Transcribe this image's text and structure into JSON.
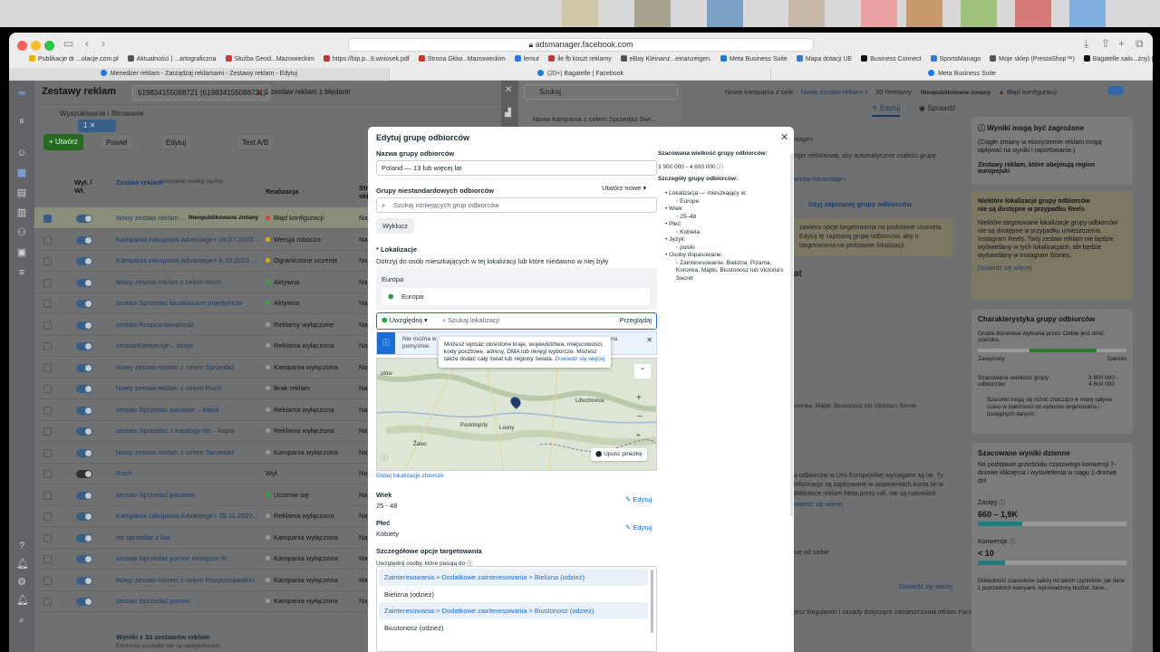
{
  "browser": {
    "url": "adsmanager.facebook.com",
    "bookmarks": [
      "Publikacje dr ...olacje.com.pl",
      "Aktualności | ...artograficzna",
      "Służba Geod...Mazowieckim",
      "https://bip.p...9,wniosek.pdf",
      "Strona Głów...Mazowieckim",
      "lemur",
      "ile fb koszt reklamy",
      "eBay Kleinanz...einanzeigen.",
      "Meta Business Suite",
      "Mapa dotacji UE",
      "Business Connect",
      "SportsManago",
      "Moje sklep (PrestaShop™)",
      "Bagatelle salo...żny) | TikTok"
    ],
    "tabs": [
      "Menedżer reklam - Zarządzaj reklamami - Zestawy reklam - Edytuj",
      "(20+) Bagatelle | Facebook",
      "Meta Business Suite"
    ]
  },
  "app": {
    "section_title": "Zestawy reklam",
    "account_selector": "619834155088721 (619834155088721)",
    "error_badge": "1 zestaw reklam z błędami",
    "search_placeholder": "Wyszukiwanie i filtrowanie",
    "toolbar": {
      "create": "+ Utwórz",
      "duplicate": "Powiel",
      "edit": "Edytuj",
      "ab_test": "Test A/B",
      "selected_count": "1"
    },
    "table_headers": {
      "toggle": "Wył. / Wł.",
      "name": "Zestaw reklam",
      "name_sort": "sortowanie według błędów",
      "delivery": "Realizacja",
      "budget": "Strate składa"
    },
    "rows": [
      {
        "name": "Nowy zestaw reklam ...",
        "badge": "Nieopublikowane zmiany",
        "status": "Błąd konfiguracji",
        "dot": "#d64545",
        "budget": "Naje"
      },
      {
        "name": "Kampania zakupowa Advantage+ 28.07.2023 ...",
        "status": "Wersja robocza",
        "dot": "#e0b000",
        "budget": "Naje"
      },
      {
        "name": "Kampania zakupowa Advantage+ 6.10.2023 ...",
        "status": "Ograniczone uczenie",
        "dot": "#e0b000",
        "budget": "Naje"
      },
      {
        "name": "Nowy zestaw reklam z celem Ruch",
        "status": "Aktywna",
        "dot": "#33a33a",
        "budget": "Naje"
      },
      {
        "name": "zestaw Sprzedaż biustonosze pojedyńcze",
        "status": "Aktywna",
        "dot": "#33a33a",
        "budget": "Naje"
      },
      {
        "name": "zestaw Rozpoznawalność",
        "status": "Reklamy wyłączone",
        "dot": "#999",
        "budget": "Naje"
      },
      {
        "name": "zestawKonwersje – stroje",
        "status": "Reklama wyłączona",
        "dot": "#999",
        "budget": "Naje"
      },
      {
        "name": "Nowy zestaw reklam z celem Sprzedaż",
        "status": "Kampania wyłączona",
        "dot": "#999",
        "budget": "Naje"
      },
      {
        "name": "Nowy zestaw reklam z celem Ruch",
        "status": "Brak reklam",
        "dot": "#999",
        "budget": "Naje"
      },
      {
        "name": "zestaw Sprzedaż panowie – kopia",
        "status": "Reklama wyłączona",
        "dot": "#999",
        "budget": "Naje"
      },
      {
        "name": "zestaw Sprzedaż z katalogu ret – kopia",
        "status": "Reklama wyłączona",
        "dot": "#999",
        "budget": "Naje"
      },
      {
        "name": "Nowy zestaw reklam z celem Sprzedaż",
        "status": "Kampania wyłączona",
        "dot": "#999",
        "budget": "Naje"
      },
      {
        "name": "Ruch",
        "status": "Wył.",
        "dot": "",
        "budget": "Naje"
      },
      {
        "name": "zestaw Sprzedaż panowie",
        "status": "Uczenie się",
        "dot": "#33a33a",
        "budget": "Naje"
      },
      {
        "name": "Kampania zakupowa Advantage+ 28.11.2022...",
        "status": "Reklama wyłączona",
        "dot": "#999",
        "budget": "Naje"
      },
      {
        "name": "ret sprzedaż z kat",
        "status": "Kampania wyłączona",
        "dot": "#999",
        "budget": "Naje"
      },
      {
        "name": "zestaw Sprzedaż pomoc mniejsze %",
        "status": "Kampania wyłączona",
        "dot": "#999",
        "budget": "Naje"
      },
      {
        "name": "Nowy zestaw reklam z celem Rozpoznawalno...",
        "status": "Kampania wyłączona",
        "dot": "#999",
        "budget": "Naje"
      },
      {
        "name": "zestaw Sprzedaż pomoc",
        "status": "Kampania wyłączona",
        "dot": "#999",
        "budget": "Naje"
      }
    ],
    "footer_title": "Wyniki z 33 zestawów reklam",
    "footer_sub": "Elementy usunięte nie są uwzględnione",
    "campaign_search": "Szukaj",
    "campaign_item": "Nowa kampania z celem Sprzedaż Swr...",
    "breadcrumb": [
      "Nowa kampania z cele",
      "Nowy zestaw reklam z",
      "30 Reklamy"
    ],
    "breadcrumb_status": "Nieopublikowane zmiany",
    "config_error": "Błąd konfiguracji",
    "edit_tab": "Edytuj",
    "review_tab": "Sprawdź"
  },
  "right_panel": {
    "warn_title": "Wyniki mogą być zagrożone",
    "warn_text": "(Ciągłe zmiany w ekosystemie reklam mogą wpływać na wyniki i raportowanie.)",
    "warn_sub": "Zestawy reklam, które obejmują region europejski",
    "reels_title": "Niektóre lokalizacje grupy odbiorców nie są dostępne w przypadku Reels",
    "reels_text": "Niektóre targetowane lokalizacje grupy odbiorców nie są dostępne w przypadku umieszczenia Instagram Reels. Twój zestaw reklam nie będzie wyświetlany w tych lokalizacjach, ale będzie wyświetlany w Instagram Stories.",
    "learn_more": "Dowiedz się więcej",
    "char_title": "Charakterystyka grupy odbiorców",
    "char_text": "Grupa docelowa wybrana przez Ciebie jest dość szeroka.",
    "narrow": "Zawężony",
    "broad": "Szeroki",
    "est_size_label": "Szacowana wielkość grupy odbiorców:",
    "est_size": "3 900 000 - 4 600 000",
    "est_note": "Szacunki mogą się różnić znacząco w miarę upływu czasu w zależności od wyborów targetowania i dostępnych danych.",
    "daily_title": "Szacowane wyniki dzienne",
    "daily_text": "Na podstawie przedziału czasowego konwersji 7-dniowe kliknięcia i wyświetlenia w ciągu 1-dniowe dni",
    "reach_label": "Zasięg",
    "reach_val": "660 – 1,9K",
    "conv_label": "Konwersje",
    "conv_val": "< 10",
    "accuracy": "Dokładność szacunków zależy od takich czynników, jak dane z poprzednich kampanii, wprowadzony budżet, dane...",
    "bg_text_1": "ntage+",
    "bg_text_2": "ogie reklamową, aby automatycznie znaleźć grupę",
    "bg_text_3": "orców Advantage+",
    "bg_tab": "Użyj zapisanej grupy odbiorców",
    "bg_text_4": "zawiera opcje targetowania na podstawie usunięta. Edytuj tę zapisaną grupę odbiorców, aby o targetowania na podstawie lokalizacji.",
    "bg_text_5": "at",
    "bg_text_6": "oronka, Majtki, Biustonosz lub Victoria's Secret",
    "bg_text_7": "a odbiorców w Unii Europejskiej wymagane są ne. Ty informacje są zapisywane w ustawieniach konta tie w Bibliotece reklam Meta przez rok, nie są natomiast",
    "bg_link": "owiedz się więcej",
    "bg_text_8": "się od siebie",
    "bg_link2": "Dowiedz się więcej",
    "bg_footer": "jesz Regulamin i zasady dotyczące zamieszczania reklam Facebooka."
  },
  "modal": {
    "title": "Edytuj grupę odbiorców",
    "name_label": "Nazwa grupy odbiorców",
    "name_value": "Poland — 13 lub więcej lat",
    "custom_label": "Grupy niestandardowych odbiorców",
    "create_new": "Utwórz nowe",
    "custom_placeholder": "Szukaj istniejących grup odbiorców",
    "exclude_btn": "Wyklucz",
    "loc_label": "* Lokalizacje",
    "loc_desc": "Dotrzyj do osób mieszkających w tej lokalizacji lub które niedawno w niej były",
    "loc_group": "Europa",
    "loc_item": "Europa",
    "include_select": "Uwzględnij",
    "loc_search": "Szukaj lokalizacji",
    "browse": "Przeglądaj",
    "notice_text": "Nie można w",
    "notice_text2": "pomyślnie.",
    "notice_tail": "na",
    "tooltip": "Możesz wpisać określone kraje, województwa, miejscowości, kody pocztowe, adresy, DMA lub okręgi wyborcze. Możesz także dodać cały świat lub regiony świata.",
    "tooltip_link": "Dowiedz się więcej",
    "map_labels": [
      "utów",
      "Libochovice",
      "Postoloprty",
      "Louny",
      "Žatec"
    ],
    "drop_pin": "Upuść pinezkę",
    "add_bulk": "Dodaj lokalizacje zbiorcze",
    "age_label": "Wiek",
    "age_value": "25 - 48",
    "gender_label": "Płeć",
    "gender_value": "Kobiety",
    "edit_link": "Edytuj",
    "detailed_label": "Szczegółowe opcje targetowania",
    "detailed_sub": "Uwzględnij osoby, które pasują do",
    "paths": [
      {
        "path": "Zainteresowania > Dodatkowe zainteresowania > Bielizna (odzież)",
        "item": "Bielizna (odzież)"
      },
      {
        "path": "Zainteresowania > Dodatkowe zainteresowania > Biustonosz (odzież)",
        "item": "Biustonosz (odzież)"
      }
    ],
    "side_size_label": "Szacowana wielkość grupy odbiorców:",
    "side_size": "3 900 000 - 4 600 000",
    "side_details_label": "Szczegóły grupy odbiorców:",
    "side_details": [
      {
        "text": "Lokalizacja — mieszkający w:",
        "level": 1
      },
      {
        "text": "Europe",
        "level": 2
      },
      {
        "text": "Wiek:",
        "level": 1
      },
      {
        "text": "25–48",
        "level": 2
      },
      {
        "text": "Płeć:",
        "level": 1
      },
      {
        "text": "Kobieta",
        "level": 2
      },
      {
        "text": "Język:",
        "level": 1
      },
      {
        "text": "polski",
        "level": 2
      },
      {
        "text": "Osoby dopasowane:",
        "level": 1
      },
      {
        "text": "Zainteresowanie: Bielizna, Piżama, Koronka, Majtki, Biustonosz lub Victoria's Secret",
        "level": 2
      }
    ]
  },
  "colors": {
    "accent": "#1877f2",
    "create_green": "#42b72a",
    "error": "#e41e3f",
    "bar_teal": "#29a3a3"
  }
}
